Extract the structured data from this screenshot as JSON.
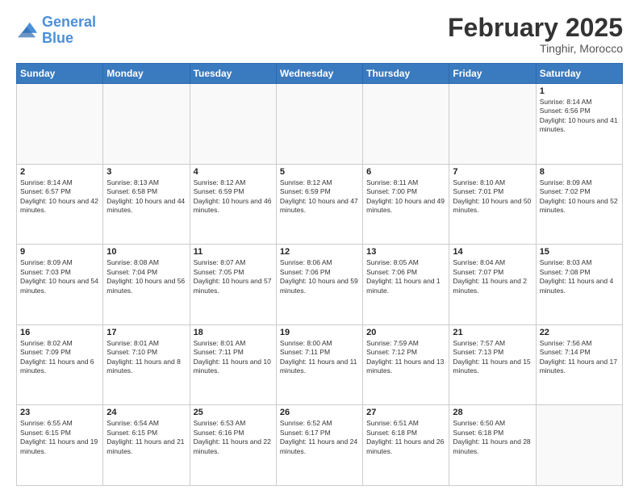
{
  "logo": {
    "line1": "General",
    "line2": "Blue"
  },
  "header": {
    "month": "February 2025",
    "location": "Tinghir, Morocco"
  },
  "weekdays": [
    "Sunday",
    "Monday",
    "Tuesday",
    "Wednesday",
    "Thursday",
    "Friday",
    "Saturday"
  ],
  "weeks": [
    [
      {
        "day": "",
        "info": ""
      },
      {
        "day": "",
        "info": ""
      },
      {
        "day": "",
        "info": ""
      },
      {
        "day": "",
        "info": ""
      },
      {
        "day": "",
        "info": ""
      },
      {
        "day": "",
        "info": ""
      },
      {
        "day": "1",
        "info": "Sunrise: 8:14 AM\nSunset: 6:56 PM\nDaylight: 10 hours and 41 minutes."
      }
    ],
    [
      {
        "day": "2",
        "info": "Sunrise: 8:14 AM\nSunset: 6:57 PM\nDaylight: 10 hours and 42 minutes."
      },
      {
        "day": "3",
        "info": "Sunrise: 8:13 AM\nSunset: 6:58 PM\nDaylight: 10 hours and 44 minutes."
      },
      {
        "day": "4",
        "info": "Sunrise: 8:12 AM\nSunset: 6:59 PM\nDaylight: 10 hours and 46 minutes."
      },
      {
        "day": "5",
        "info": "Sunrise: 8:12 AM\nSunset: 6:59 PM\nDaylight: 10 hours and 47 minutes."
      },
      {
        "day": "6",
        "info": "Sunrise: 8:11 AM\nSunset: 7:00 PM\nDaylight: 10 hours and 49 minutes."
      },
      {
        "day": "7",
        "info": "Sunrise: 8:10 AM\nSunset: 7:01 PM\nDaylight: 10 hours and 50 minutes."
      },
      {
        "day": "8",
        "info": "Sunrise: 8:09 AM\nSunset: 7:02 PM\nDaylight: 10 hours and 52 minutes."
      }
    ],
    [
      {
        "day": "9",
        "info": "Sunrise: 8:09 AM\nSunset: 7:03 PM\nDaylight: 10 hours and 54 minutes."
      },
      {
        "day": "10",
        "info": "Sunrise: 8:08 AM\nSunset: 7:04 PM\nDaylight: 10 hours and 56 minutes."
      },
      {
        "day": "11",
        "info": "Sunrise: 8:07 AM\nSunset: 7:05 PM\nDaylight: 10 hours and 57 minutes."
      },
      {
        "day": "12",
        "info": "Sunrise: 8:06 AM\nSunset: 7:06 PM\nDaylight: 10 hours and 59 minutes."
      },
      {
        "day": "13",
        "info": "Sunrise: 8:05 AM\nSunset: 7:06 PM\nDaylight: 11 hours and 1 minute."
      },
      {
        "day": "14",
        "info": "Sunrise: 8:04 AM\nSunset: 7:07 PM\nDaylight: 11 hours and 2 minutes."
      },
      {
        "day": "15",
        "info": "Sunrise: 8:03 AM\nSunset: 7:08 PM\nDaylight: 11 hours and 4 minutes."
      }
    ],
    [
      {
        "day": "16",
        "info": "Sunrise: 8:02 AM\nSunset: 7:09 PM\nDaylight: 11 hours and 6 minutes."
      },
      {
        "day": "17",
        "info": "Sunrise: 8:01 AM\nSunset: 7:10 PM\nDaylight: 11 hours and 8 minutes."
      },
      {
        "day": "18",
        "info": "Sunrise: 8:01 AM\nSunset: 7:11 PM\nDaylight: 11 hours and 10 minutes."
      },
      {
        "day": "19",
        "info": "Sunrise: 8:00 AM\nSunset: 7:11 PM\nDaylight: 11 hours and 11 minutes."
      },
      {
        "day": "20",
        "info": "Sunrise: 7:59 AM\nSunset: 7:12 PM\nDaylight: 11 hours and 13 minutes."
      },
      {
        "day": "21",
        "info": "Sunrise: 7:57 AM\nSunset: 7:13 PM\nDaylight: 11 hours and 15 minutes."
      },
      {
        "day": "22",
        "info": "Sunrise: 7:56 AM\nSunset: 7:14 PM\nDaylight: 11 hours and 17 minutes."
      }
    ],
    [
      {
        "day": "23",
        "info": "Sunrise: 6:55 AM\nSunset: 6:15 PM\nDaylight: 11 hours and 19 minutes."
      },
      {
        "day": "24",
        "info": "Sunrise: 6:54 AM\nSunset: 6:15 PM\nDaylight: 11 hours and 21 minutes."
      },
      {
        "day": "25",
        "info": "Sunrise: 6:53 AM\nSunset: 6:16 PM\nDaylight: 11 hours and 22 minutes."
      },
      {
        "day": "26",
        "info": "Sunrise: 6:52 AM\nSunset: 6:17 PM\nDaylight: 11 hours and 24 minutes."
      },
      {
        "day": "27",
        "info": "Sunrise: 6:51 AM\nSunset: 6:18 PM\nDaylight: 11 hours and 26 minutes."
      },
      {
        "day": "28",
        "info": "Sunrise: 6:50 AM\nSunset: 6:18 PM\nDaylight: 11 hours and 28 minutes."
      },
      {
        "day": "",
        "info": ""
      }
    ]
  ]
}
